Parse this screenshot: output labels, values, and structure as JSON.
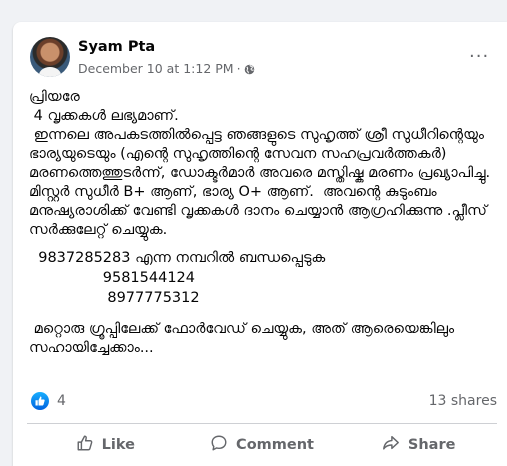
{
  "post": {
    "author": "Syam Pta",
    "timestamp": "December 10 at 1:12 PM",
    "separator": "·",
    "privacy_icon": "globe-icon",
    "more_icon": "more-options-icon",
    "more_label": "···",
    "body": {
      "greeting": "പ്രിയരേ",
      "headline": " 4 വൃക്കകൾ ലഭ്യമാണ്.",
      "paragraph": " ഇന്നലെ അപകടത്തിൽപ്പെട്ട ഞങ്ങളുടെ സുഹൃത്ത് ശ്രീ സുധീറിന്റെയും ഭാര്യയുടെയും (എന്റെ സുഹൃത്തിന്റെ സേവന സഹപ്രവർത്തകർ) മരണത്തെത്തുടർന്ന്, ഡോക്ടർമാർ അവരെ മസ്തിഷ്ക മരണം പ്രഖ്യാപിച്ചു.  മിസ്റ്റർ സുധീർ B+ ആണ്, ഭാര്യ O+ ആണ്.  അവന്റെ കുടുംബം മനുഷ്യരാശിക്ക് വേണ്ടി വൃക്കകൾ ദാനം ചെയ്യാൻ ആഗ്രഹിക്കുന്നു .പ്ലീസ് സർക്കുലേറ്റ് ചെയ്യുക.",
      "phone_line": "  9837285283 എന്ന നമ്പറിൽ ബന്ധപ്പെടുക",
      "phone_2": "                9581544124",
      "phone_3": "                 8977775312",
      "forward_note": " മറ്റൊരു ഗ്രൂപ്പിലേക്ക് ഫോർവേഡ് ചെയ്യുക, അത് ആരെയെങ്കിലും സഹായിച്ചേക്കാം..."
    }
  },
  "stats": {
    "reaction_icon": "like-reaction-icon",
    "reaction_count": "4",
    "shares": "13 shares"
  },
  "actions": [
    {
      "label": "Like",
      "icon": "thumbs-up-icon"
    },
    {
      "label": "Comment",
      "icon": "comment-icon"
    },
    {
      "label": "Share",
      "icon": "share-icon"
    }
  ],
  "colors": {
    "background": "#f0f2f5",
    "card": "#ffffff",
    "text_primary": "#050505",
    "text_secondary": "#65676b",
    "like_blue": "#1877f2"
  }
}
